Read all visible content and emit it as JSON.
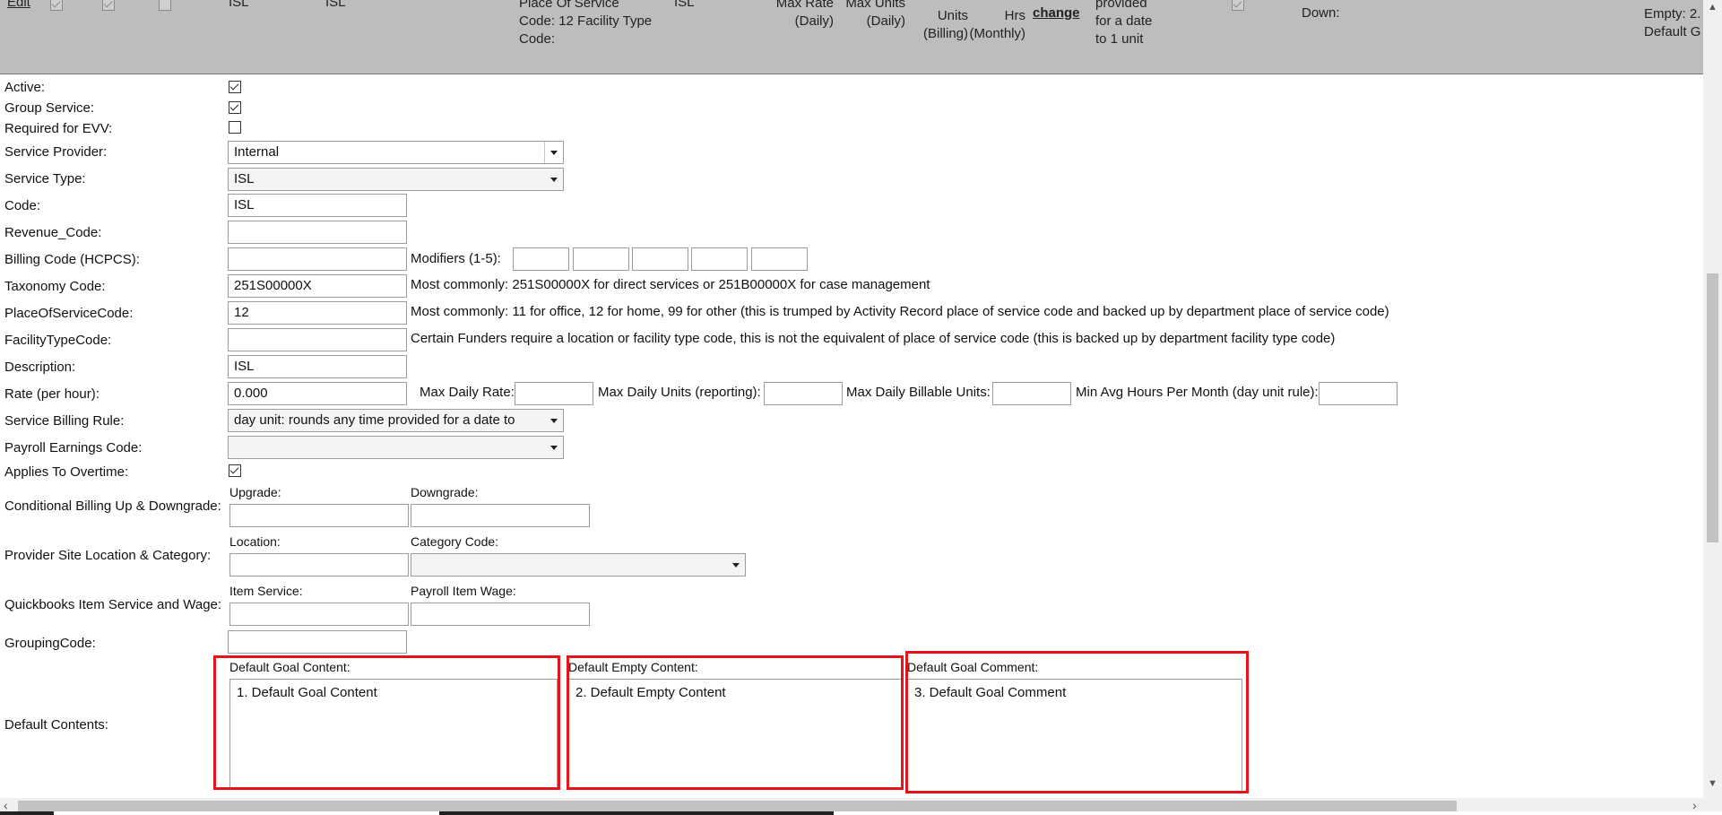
{
  "header_row": {
    "edit_link": "Edit",
    "col_name": "ISL",
    "col_code": "ISL",
    "col_place": "Place Of Service Code: 12 Facility Type Code:",
    "col_type": "ISL",
    "col_max_rate": "Max Rate (Daily)",
    "col_max_units": "Max Units (Daily)",
    "col_units_billing": "Units (Billing)",
    "col_hrs_monthly": "Hrs (Monthly)",
    "change_link": "change",
    "col_rule_fragment": "provided for a date to 1 unit",
    "col_down": "Down:",
    "col_default_fragment": "Empty: 2. Default G"
  },
  "form": {
    "active_label": "Active:",
    "active_checked": true,
    "group_service_label": "Group Service:",
    "group_service_checked": true,
    "required_evv_label": "Required for EVV:",
    "required_evv_checked": false,
    "service_provider_label": "Service Provider:",
    "service_provider_value": "Internal",
    "service_type_label": "Service Type:",
    "service_type_value": "ISL",
    "code_label": "Code:",
    "code_value": "ISL",
    "revenue_code_label": "Revenue_Code:",
    "revenue_code_value": "",
    "billing_code_label": "Billing Code (HCPCS):",
    "billing_code_value": "",
    "modifiers_label": "Modifiers (1-5):",
    "modifiers": [
      "",
      "",
      "",
      "",
      ""
    ],
    "taxonomy_label": "Taxonomy Code:",
    "taxonomy_value": "251S00000X",
    "taxonomy_hint": "Most commonly: 251S00000X for direct services or 251B00000X for case management",
    "place_of_service_label": "PlaceOfServiceCode:",
    "place_of_service_value": "12",
    "place_of_service_hint": "Most commonly: 11 for office, 12 for home, 99 for other (this is trumped by Activity Record place of service code and backed up by department place of service code)",
    "facility_type_label": "FacilityTypeCode:",
    "facility_type_value": "",
    "facility_type_hint": "Certain Funders require a location or facility type code, this is not the equivalent of place of service code (this is backed up by department facility type code)",
    "description_label": "Description:",
    "description_value": "ISL",
    "rate_label": "Rate (per hour):",
    "rate_value": "0.000",
    "max_daily_rate_label": "Max Daily Rate:",
    "max_daily_units_label": "Max Daily Units (reporting):",
    "max_daily_billable_label": "Max Daily Billable Units:",
    "min_avg_hours_label": "Min Avg Hours Per Month (day unit rule):",
    "billing_rule_label": "Service Billing Rule:",
    "billing_rule_value": "day unit: rounds any time provided for a date to",
    "payroll_label": "Payroll Earnings Code:",
    "payroll_value": "",
    "overtime_label": "Applies To Overtime:",
    "overtime_checked": true,
    "conditional_label": "Conditional Billing Up & Downgrade:",
    "upgrade_label": "Upgrade:",
    "downgrade_label": "Downgrade:",
    "provider_site_label": "Provider Site Location & Category:",
    "location_label": "Location:",
    "category_code_label": "Category Code:",
    "quickbooks_label": "Quickbooks Item Service and Wage:",
    "item_service_label": "Item Service:",
    "payroll_item_wage_label": "Payroll Item Wage:",
    "grouping_code_label": "GroupingCode:",
    "default_contents_label": "Default Contents:",
    "default_goal_content_label": "Default Goal Content:",
    "default_goal_content_value": "1. Default Goal Content",
    "default_empty_content_label": "Default Empty Content:",
    "default_empty_content_value": "2. Default Empty Content",
    "default_goal_comment_label": "Default Goal Comment:",
    "default_goal_comment_value": "3. Default Goal Comment"
  },
  "colors": {
    "header_bg": "#bdbdbd",
    "highlight_red": "#e5141b"
  }
}
